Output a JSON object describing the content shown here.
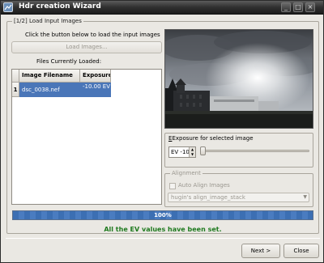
{
  "window": {
    "title": "Hdr creation Wizard",
    "minimize_glyph": "_",
    "maximize_glyph": "□",
    "close_glyph": "×"
  },
  "step_group": {
    "legend": "[1/2] Load Input Images"
  },
  "instruction": "Click the button below to load the input images",
  "load_button": {
    "label": "Load Images..."
  },
  "files_label": "Files Currently Loaded:",
  "table": {
    "columns": [
      "Image Filename",
      "Exposure"
    ],
    "rows": [
      {
        "index": "1",
        "filename": "dsc_0038.nef",
        "exposure": "-10.00 EV"
      }
    ]
  },
  "exposure_section": {
    "label": "Exposure for selected image",
    "spin_value": "EV -10",
    "spin_up": "▲",
    "spin_down": "▼",
    "slider_level": 0
  },
  "alignment": {
    "legend": "Alignment",
    "auto_align_label": "Auto Align Images",
    "method_value": "hugin's align_image_stack",
    "dropdown_glyph": "▼"
  },
  "progress": {
    "text": "100%",
    "value": 100
  },
  "status_message": "All the EV values have been set.",
  "buttons": {
    "next": "Next >",
    "close": "Close"
  },
  "colors": {
    "progress": "#3c6fb3",
    "status": "#1f7a1f",
    "selection": "#4a76b8"
  },
  "icons": [
    "app-icon",
    "minimize-icon",
    "maximize-icon",
    "close-icon"
  ]
}
